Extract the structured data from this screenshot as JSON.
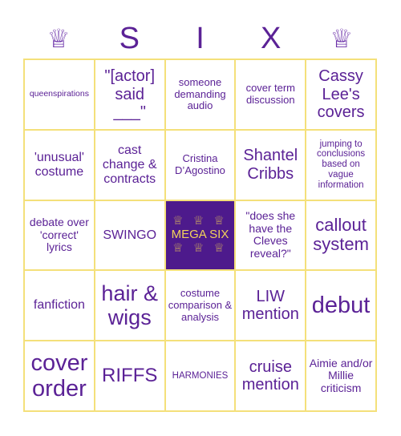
{
  "header": {
    "left_icon": "crown-icon",
    "letters": [
      "S",
      "I",
      "X"
    ],
    "right_icon": "crown-icon",
    "crown_glyph": "♕"
  },
  "colors": {
    "text": "#5b2296",
    "border": "#f4e07a",
    "free_bg": "#4d1a8c",
    "free_text": "#f2d35a",
    "free_crowns": "#c9a462"
  },
  "free_space": {
    "crowns_top": "♕ ♕ ♕",
    "label": "MEGA SIX",
    "crowns_bottom": "♕ ♕ ♕"
  },
  "board": [
    [
      "queenspirations",
      "\"[actor] said ___\"",
      "someone demanding audio",
      "cover term discussion",
      "Cassy Lee's covers"
    ],
    [
      "'unusual' costume",
      "cast change & contracts",
      "Cristina D’Agostino",
      "Shantel Cribbs",
      "jumping to conclusions based on vague information"
    ],
    [
      "debate over 'correct' lyrics",
      "SWINGO",
      "MEGA SIX",
      "\"does she have the Cleves reveal?\"",
      "callout system"
    ],
    [
      "fanfiction",
      "hair & wigs",
      "costume comparison & analysis",
      "LIW mention",
      "debut"
    ],
    [
      "cover order",
      "RIFFS",
      "HARMONIES",
      "cruise mention",
      "Aimie and/or Millie criticism"
    ]
  ]
}
